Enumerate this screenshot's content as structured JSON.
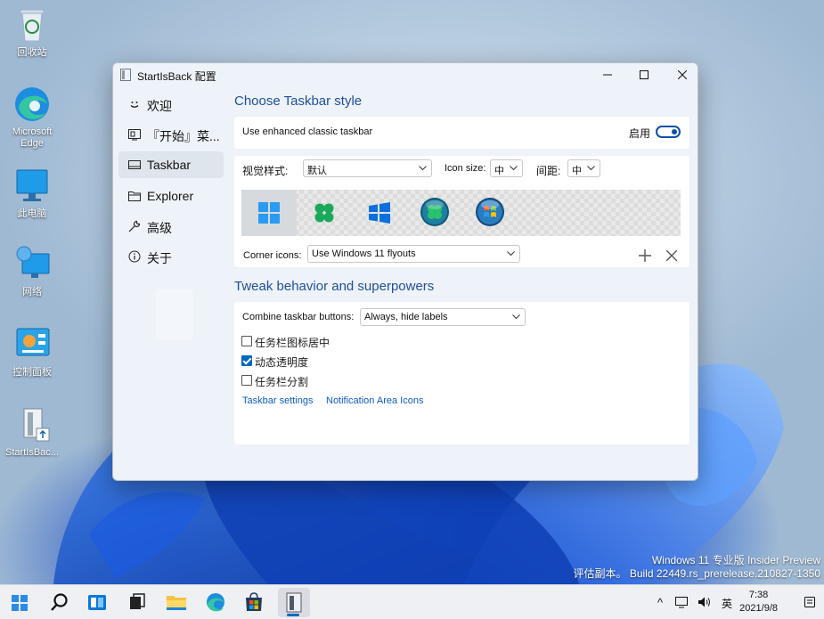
{
  "desktop": {
    "icons": [
      {
        "label": "回收站",
        "icon": "recycle-bin-icon"
      },
      {
        "label": "Microsoft Edge",
        "icon": "edge-icon"
      },
      {
        "label": "此电脑",
        "icon": "monitor-icon"
      },
      {
        "label": "网络",
        "icon": "network-icon"
      },
      {
        "label": "控制面板",
        "icon": "control-panel-icon"
      },
      {
        "label": "StartIsBac...",
        "icon": "startisback-file-icon"
      }
    ],
    "watermark": {
      "line1": "Windows 11 专业版 Insider Preview",
      "line2": "评估副本。 Build 22449.rs_prerelease.210827-1350"
    }
  },
  "window": {
    "title": "StartIsBack 配置",
    "nav": [
      {
        "label": "欢迎",
        "icon": "smiley-icon"
      },
      {
        "label": "『开始』菜...",
        "icon": "start-menu-icon"
      },
      {
        "label": "Taskbar",
        "icon": "taskbar-icon"
      },
      {
        "label": "Explorer",
        "icon": "folder-icon"
      },
      {
        "label": "高级",
        "icon": "wrench-icon"
      },
      {
        "label": "关于",
        "icon": "info-icon"
      }
    ],
    "selected_nav": "Taskbar",
    "style_section": {
      "title": "Choose Taskbar style",
      "enhanced_label": "Use enhanced classic taskbar",
      "enabled_label": "启用",
      "enabled": true,
      "visual_style_label": "视觉样式:",
      "visual_style_value": "默认",
      "icon_size_label": "Icon size:",
      "icon_size_value": "中",
      "spacing_label": "间距:",
      "spacing_value": "中",
      "styles": [
        "windows-11-icon",
        "clover-icon",
        "windows-10-icon",
        "clover-orb-icon",
        "windows-7-orb-icon"
      ],
      "selected_style_index": 0,
      "corner_icons_label": "Corner icons:",
      "corner_icons_value": "Use Windows 11 flyouts"
    },
    "behavior_section": {
      "title": "Tweak behavior and superpowers",
      "combine_label": "Combine taskbar buttons:",
      "combine_value": "Always, hide labels",
      "checkboxes": [
        {
          "label": "任务栏图标居中",
          "checked": false
        },
        {
          "label": "动态透明度",
          "checked": true
        },
        {
          "label": "任务栏分割",
          "checked": false
        }
      ],
      "links": [
        "Taskbar settings",
        "Notification Area Icons"
      ]
    }
  },
  "taskbar": {
    "pinned": [
      "start-icon",
      "search-icon",
      "widgets-icon",
      "task-view-icon",
      "file-explorer-icon",
      "edge-icon",
      "store-icon",
      "startisback-icon"
    ],
    "active_app": "startisback-icon",
    "tray": {
      "chevron": "^",
      "ime": "英"
    },
    "clock": {
      "time": "7:38",
      "date": "2021/9/8"
    }
  },
  "colors": {
    "accent": "#0067c0",
    "title_blue": "#1f4e9c",
    "window_bg": "#eef3f9"
  }
}
